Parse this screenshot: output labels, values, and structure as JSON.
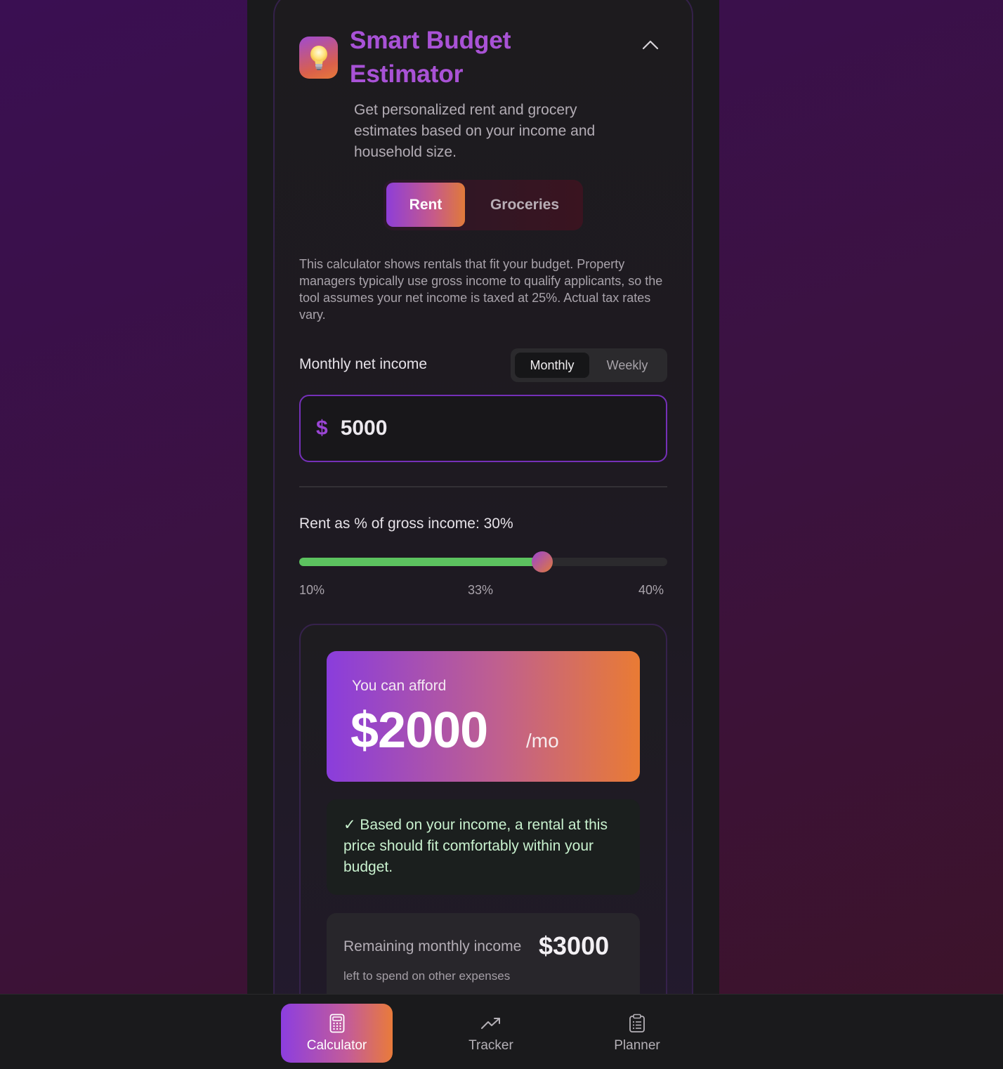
{
  "header": {
    "title": "Smart Budget Estimator",
    "icon": "lightbulb-icon",
    "subtitle": "Get personalized rent and grocery estimates based on your income and household size."
  },
  "tabs": [
    {
      "label": "Rent",
      "active": true
    },
    {
      "label": "Groceries",
      "active": false
    }
  ],
  "description": "This calculator shows rentals that fit your budget. Property managers typically use gross income to qualify applicants, so the tool assumes your net income is taxed at 25%. Actual tax rates vary.",
  "income": {
    "label": "Monthly net income",
    "period_options": [
      "Monthly",
      "Weekly"
    ],
    "selected_period": "Monthly",
    "currency_symbol": "$",
    "value": "5000"
  },
  "slider": {
    "label": "Rent as % of gross income: 30%",
    "value_fraction": 0.66,
    "ticks": [
      "10%",
      "33%",
      "40%"
    ]
  },
  "result": {
    "afford_label": "You can afford",
    "afford_amount": "$2000",
    "afford_unit": "/mo",
    "note": "✓ Based on your income, a rental at this price should fit comfortably within your budget.",
    "remaining_label": "Remaining monthly income",
    "remaining_amount": "$3000",
    "remaining_sub": "left to spend on other expenses"
  },
  "nav": [
    {
      "label": "Calculator",
      "icon": "calculator-icon",
      "active": true
    },
    {
      "label": "Tracker",
      "icon": "trend-up-icon",
      "active": false
    },
    {
      "label": "Planner",
      "icon": "clipboard-icon",
      "active": false
    }
  ],
  "colors": {
    "accent_purple": "#8e3ed8",
    "accent_orange": "#e07a3a",
    "slider_fill": "#5cc25f",
    "note_text": "#c9f2cf"
  }
}
